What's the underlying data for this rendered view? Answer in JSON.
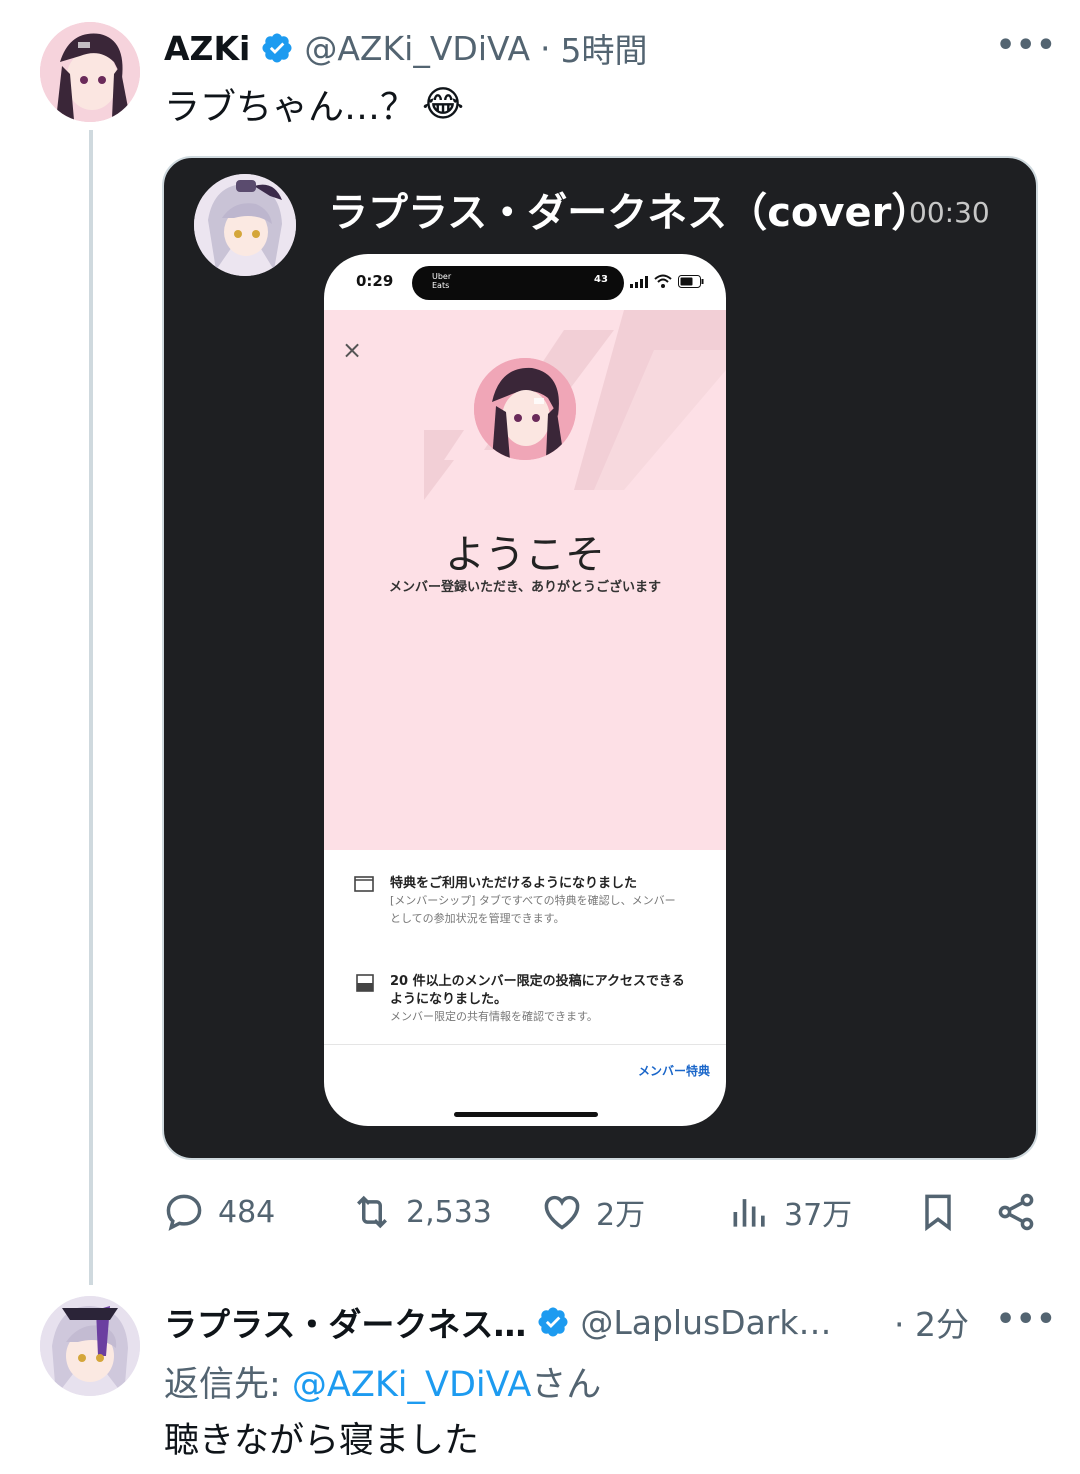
{
  "tweet": {
    "author_name": "AZKi",
    "author_handle": "@AZKi_VDiVA",
    "time": "5時間",
    "text": "ラブちゃん…？",
    "emoji": "😂",
    "media": {
      "channel_name": "ラプラス・ダークネス（cover）",
      "timestamp": "00:30",
      "phone": {
        "status_time": "0:29",
        "island_app": "Uber Eats",
        "island_count": "43",
        "close_label": "×",
        "welcome_title": "ようこそ",
        "welcome_subtitle": "メンバー登録いただき、ありがとうございます",
        "benefit1_title": "特典をご利用いただけるようになりました",
        "benefit1_desc_line1": "[メンバーシップ] タブですべての特典を確認し、メンバー",
        "benefit1_desc_line2": "としての参加状況を管理できます。",
        "benefit2_title_line1": "20 件以上のメンバー限定の投稿にアクセスできる",
        "benefit2_title_line2": "ようになりました。",
        "benefit2_desc": "メンバー限定の共有情報を確認できます。",
        "member_link": "メンバー特典"
      }
    },
    "stats": {
      "replies": "484",
      "retweets": "2,533",
      "likes": "2万",
      "views": "37万"
    }
  },
  "reply": {
    "author_name": "ラプラス・ダークネス…",
    "author_handle": "@LaplusDark…",
    "time": "· 2分",
    "reply_to_prefix": "返信先: ",
    "reply_to_handle": "@AZKi_VDiVA",
    "reply_to_suffix": "さん",
    "text": "聴きながら寝ました"
  },
  "colors": {
    "verified": "#1d9bf0",
    "link": "#1d9bf0",
    "secondary": "#536471",
    "media_bg": "#1e1f22",
    "phone_pink": "#fde0e6"
  }
}
